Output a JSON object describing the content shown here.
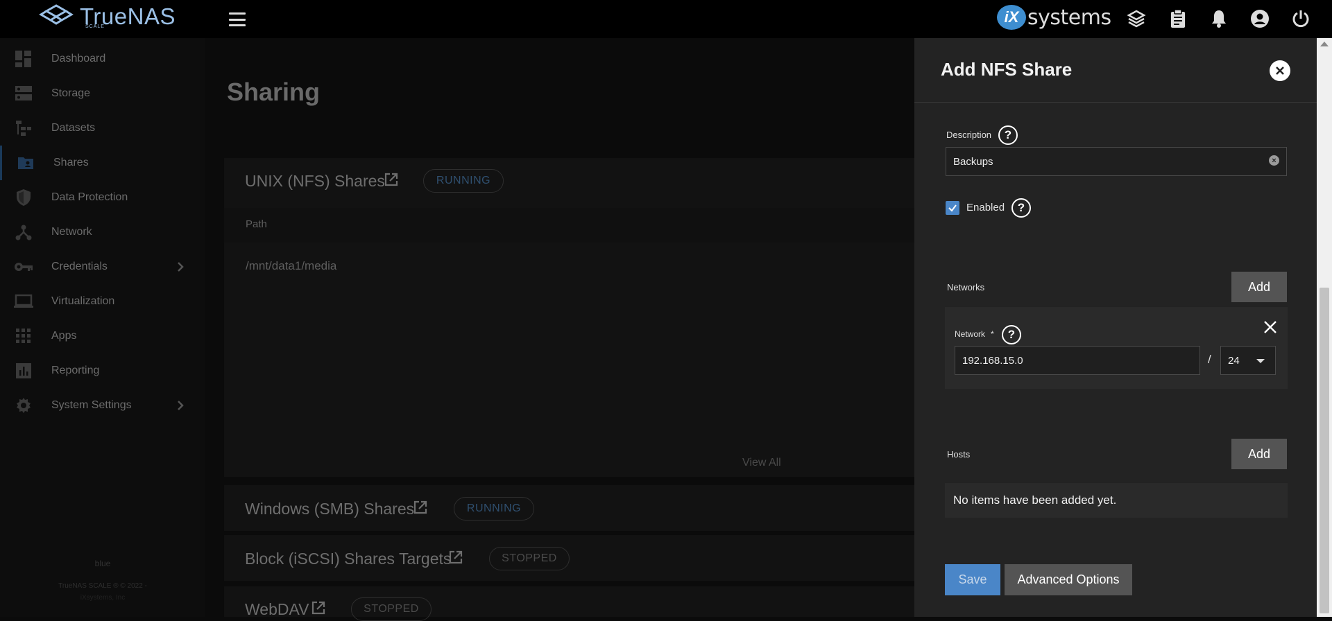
{
  "topbar": {
    "brand": "TrueNAS",
    "brand_sub": "SCALE",
    "ix_logo_badge": "iX",
    "ix_logo_text": "systems",
    "icons": [
      "truecommand-icon",
      "clipboard-icon",
      "bell-icon",
      "account-icon",
      "power-icon"
    ]
  },
  "sidebar": {
    "items": [
      {
        "label": "Dashboard",
        "icon": "dashboard-icon"
      },
      {
        "label": "Storage",
        "icon": "storage-icon"
      },
      {
        "label": "Datasets",
        "icon": "datasets-icon"
      },
      {
        "label": "Shares",
        "icon": "shares-icon"
      },
      {
        "label": "Data Protection",
        "icon": "shield-icon"
      },
      {
        "label": "Network",
        "icon": "network-icon"
      },
      {
        "label": "Credentials",
        "icon": "key-icon"
      },
      {
        "label": "Virtualization",
        "icon": "laptop-icon"
      },
      {
        "label": "Apps",
        "icon": "apps-grid-icon"
      },
      {
        "label": "Reporting",
        "icon": "chart-icon"
      },
      {
        "label": "System Settings",
        "icon": "gear-icon"
      }
    ],
    "footer_host": "blue",
    "footer_version": "TrueNAS SCALE ® © 2022 -",
    "footer_company": "iXsystems, Inc"
  },
  "main": {
    "title": "Sharing",
    "nfs": {
      "title": "UNIX (NFS) Shares",
      "status": "RUNNING",
      "col_path": "Path",
      "row_path": "/mnt/data1/media",
      "view_all": "View All"
    },
    "smb": {
      "title": "Windows (SMB) Shares",
      "status": "RUNNING"
    },
    "iscsi": {
      "title": "Block (iSCSI) Shares Targets",
      "status": "STOPPED"
    },
    "webdav": {
      "title": "WebDAV",
      "status": "STOPPED"
    }
  },
  "panel": {
    "title": "Add NFS Share",
    "description_label": "Description",
    "description_value": "Backups",
    "enabled_label": "Enabled",
    "enabled_checked": true,
    "networks_label": "Networks",
    "add_label": "Add",
    "network_label": "Network",
    "network_required": "*",
    "network_value": "192.168.15.0",
    "slash": "/",
    "mask_value": "24",
    "hosts_label": "Hosts",
    "hosts_empty": "No items have been added yet.",
    "save_label": "Save",
    "advanced_label": "Advanced Options",
    "help_glyph": "?",
    "clear_glyph": "×"
  },
  "colors": {
    "accent": "#4a86c8",
    "panel_bg": "#232323",
    "topbar_bg": "#000000"
  }
}
